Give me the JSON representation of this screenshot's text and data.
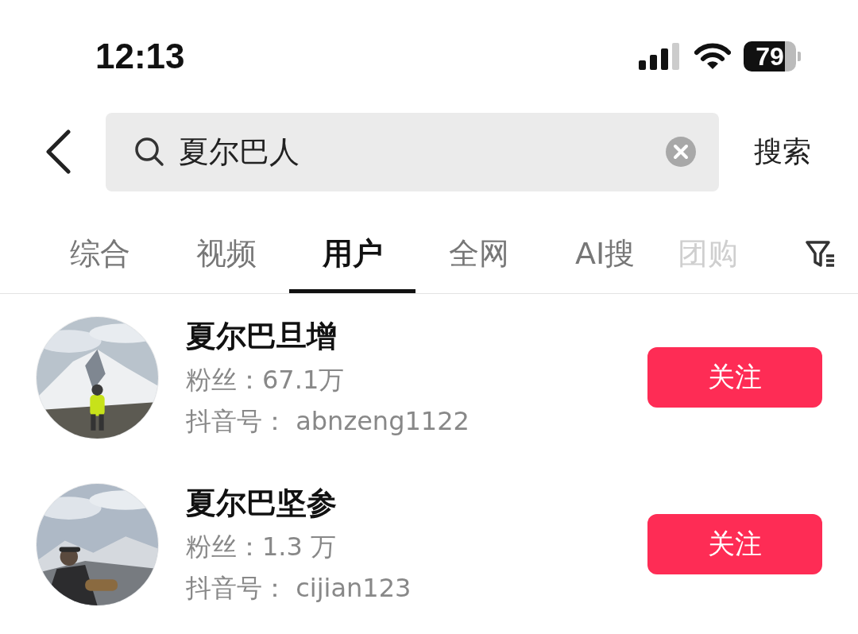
{
  "status_bar": {
    "time": "12:13",
    "battery": "79"
  },
  "search": {
    "value": "夏尔巴人",
    "action": "搜索"
  },
  "tabs": [
    {
      "label": "综合",
      "selected": false
    },
    {
      "label": "视频",
      "selected": false
    },
    {
      "label": "用户",
      "selected": true
    },
    {
      "label": "全网",
      "selected": false
    },
    {
      "label": "AI搜",
      "selected": false
    },
    {
      "label": "团购",
      "selected": false
    }
  ],
  "users": [
    {
      "name": "夏尔巴旦增",
      "fans": "粉丝：67.1万",
      "account": "抖音号： abnzeng1122",
      "button": "关注"
    },
    {
      "name": "夏尔巴坚参",
      "fans": "粉丝：1.3 万",
      "account": "抖音号： cijian123",
      "button": "关注"
    }
  ]
}
